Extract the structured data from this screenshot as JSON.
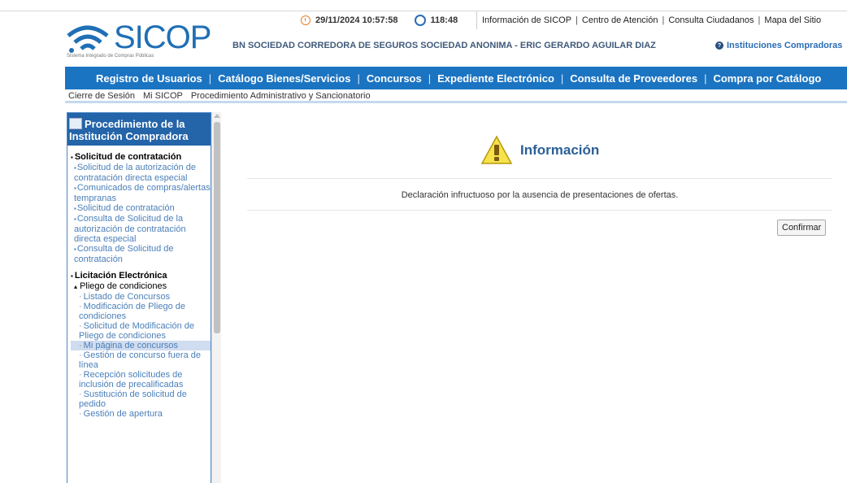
{
  "topbar": {
    "datetime": "29/11/2024 10:57:58",
    "timer": "118:48",
    "links": [
      "Información de SICOP",
      "Centro de Atención",
      "Consulta Ciudadanos",
      "Mapa del Sitio"
    ]
  },
  "logo": {
    "text": "SICOP",
    "subtitle": "Sistema Integrado de Compras Públicas"
  },
  "header": {
    "company": "BN SOCIEDAD CORREDORA DE SEGUROS SOCIEDAD ANONIMA - ERIC GERARDO AGUILAR DIAZ",
    "instituciones": "Instituciones Compradoras"
  },
  "nav": {
    "items": [
      "Registro de Usuarios",
      "Catálogo Bienes/Servicios",
      "Concursos",
      "Expediente Electrónico",
      "Consulta de Proveedores",
      "Compra por Catálogo"
    ]
  },
  "subnav": {
    "items": [
      "Cierre de Sesión",
      "Mi SICOP",
      "Procedimiento Administrativo y Sancionatorio"
    ]
  },
  "sidebar": {
    "title": "Procedimiento de la Institución Compradora",
    "section1": "Solicitud de contratación",
    "section1_items": [
      "Solicitud de la autorización de contratación directa especial",
      "Comunicados de compras/alertas tempranas",
      "Solicitud de contratación",
      "Consulta de Solicitud de la autorización de contratación directa especial",
      "Consulta de Solicitud de contratación"
    ],
    "section2": "Licitación Electrónica",
    "subsection": "Pliego de condiciones",
    "subsection_items": [
      "Listado de Concursos",
      "Modificación de Pliego de condiciones",
      "Solicitud de Modificación de Pliego de condiciones",
      "Mi página de concursos",
      "Gestión de concurso fuera de línea",
      "Recepción solicitudes de inclusión de precalificadas",
      "Sustitución de solicitud de pedido",
      "Gestión de apertura"
    ]
  },
  "main": {
    "title": "Información",
    "message": "Declaración infructuoso por la ausencia de presentaciones de ofertas.",
    "confirm_label": "Confirmar"
  },
  "colors": {
    "nav": "#1b74c2",
    "sidebar_head": "#2464a8",
    "link": "#4a7fb8",
    "logo": "#1f6fb5"
  }
}
